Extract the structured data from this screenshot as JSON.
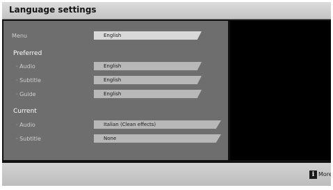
{
  "title": "Language settings",
  "menu": {
    "label": "Menu",
    "value": "English"
  },
  "preferred": {
    "heading": "Preferred",
    "audio": {
      "label": "· Audio",
      "value": "English"
    },
    "subtitle": {
      "label": "· Subtitle",
      "value": "English"
    },
    "guide": {
      "label": "· Guide",
      "value": "English"
    }
  },
  "current": {
    "heading": "Current",
    "audio": {
      "label": "· Audio",
      "value": "Italian (Clean effects)"
    },
    "subtitle": {
      "label": "· Subtitle",
      "value": "None"
    }
  },
  "footer": {
    "info_icon": "i",
    "more_label": "More"
  }
}
